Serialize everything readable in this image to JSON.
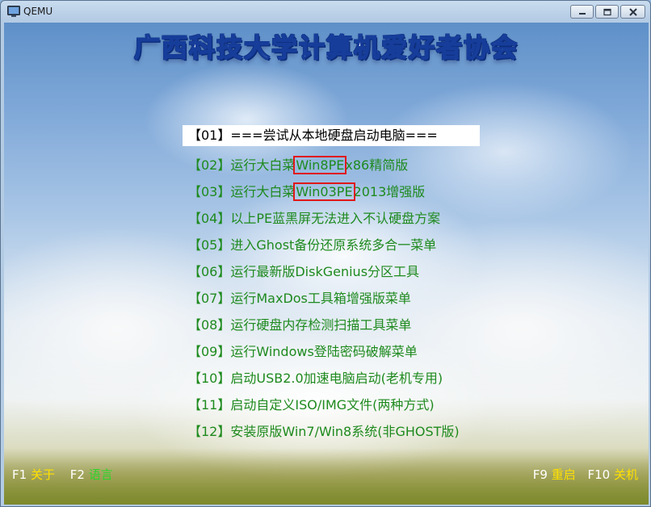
{
  "window": {
    "title": "QEMU"
  },
  "banner": {
    "text": "广西科技大学计算机爱好者协会"
  },
  "menu": {
    "items": [
      {
        "label": "【01】===尝试从本地硬盘启动电脑===",
        "selected": true
      },
      {
        "pre": "【02】运行大白菜",
        "highlight": "Win8PE",
        "post": "x86精简版"
      },
      {
        "pre": "【03】运行大白菜",
        "highlight": "Win03PE",
        "post": "2013增强版"
      },
      {
        "label": "【04】以上PE蓝黑屏无法进入不认硬盘方案"
      },
      {
        "label": "【05】进入Ghost备份还原系统多合一菜单"
      },
      {
        "label": "【06】运行最新版DiskGenius分区工具"
      },
      {
        "label": "【07】运行MaxDos工具箱增强版菜单"
      },
      {
        "label": "【08】运行硬盘内存检测扫描工具菜单"
      },
      {
        "label": "【09】运行Windows登陆密码破解菜单"
      },
      {
        "label": "【10】启动USB2.0加速电脑启动(老机专用)"
      },
      {
        "label": "【11】启动自定义ISO/IMG文件(两种方式)"
      },
      {
        "label": "【12】安装原版Win7/Win8系统(非GHOST版)"
      }
    ]
  },
  "hotkeys": {
    "left": [
      {
        "key": "F1",
        "label": "关于"
      },
      {
        "key": "F2",
        "label": "语言"
      }
    ],
    "right": [
      {
        "key": "F9",
        "label": "重启"
      },
      {
        "key": "F10",
        "label": "关机"
      }
    ]
  },
  "colors": {
    "menu_text": "#1e8a1e",
    "selected_bg": "#ffffff",
    "highlight_box": "#e01818",
    "hotkey_label": "#ffe000",
    "hotkey_label_alt": "#2cd42c",
    "banner_outline": "#163d9a"
  }
}
